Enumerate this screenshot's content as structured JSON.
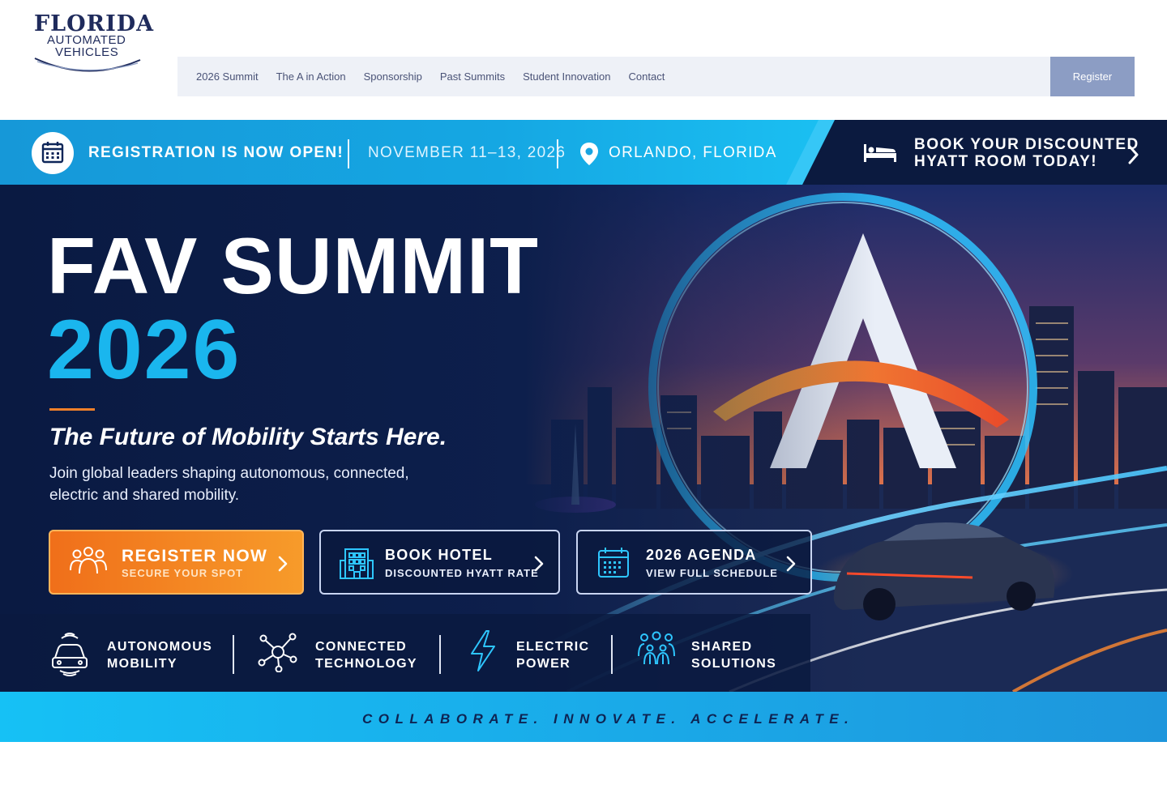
{
  "logo": {
    "line1": "FLORIDA",
    "line2": "AUTOMATED",
    "line3": "VEHICLES",
    "alt": "Florida Automated Vehicles"
  },
  "nav": {
    "items": [
      "2026 Summit",
      "The A in Action",
      "Sponsorship",
      "Past Summits",
      "Student Innovation",
      "Contact"
    ],
    "register_label": "Register"
  },
  "banner": {
    "topbar": {
      "registration": "REGISTRATION IS NOW OPEN!",
      "dates": "NOVEMBER 11–13, 2026",
      "location": "ORLANDO, FLORIDA",
      "hotel_line1": "BOOK YOUR DISCOUNTED",
      "hotel_line2": "HYATT ROOM TODAY!"
    },
    "title_line1": "FAV SUMMIT",
    "title_line2": "2026",
    "tagline": "The Future of Mobility Starts Here.",
    "description": "Join global leaders shaping autonomous, connected, electric and shared mobility.",
    "ctas": [
      {
        "title": "REGISTER NOW",
        "subtitle": "SECURE YOUR SPOT",
        "icon": "people-icon"
      },
      {
        "title": "BOOK HOTEL",
        "subtitle": "DISCOUNTED HYATT RATE",
        "icon": "building-icon"
      },
      {
        "title": "2026 AGENDA",
        "subtitle": "VIEW FULL SCHEDULE",
        "icon": "calendar-icon"
      }
    ],
    "pillars": [
      {
        "line1": "AUTONOMOUS",
        "line2": "MOBILITY",
        "icon": "autonomous-car-icon"
      },
      {
        "line1": "CONNECTED",
        "line2": "TECHNOLOGY",
        "icon": "network-icon"
      },
      {
        "line1": "ELECTRIC",
        "line2": "POWER",
        "icon": "lightning-icon"
      },
      {
        "line1": "SHARED",
        "line2": "SOLUTIONS",
        "icon": "group-icon"
      }
    ],
    "motto": "COLLABORATE. INNOVATE. ACCELERATE."
  },
  "colors": {
    "brand_navy": "#1f2b5c",
    "accent_cyan": "#1ab6ee",
    "accent_orange": "#f07a22",
    "nav_bg": "#eef1f7",
    "register_bg": "#8c9dc4"
  }
}
